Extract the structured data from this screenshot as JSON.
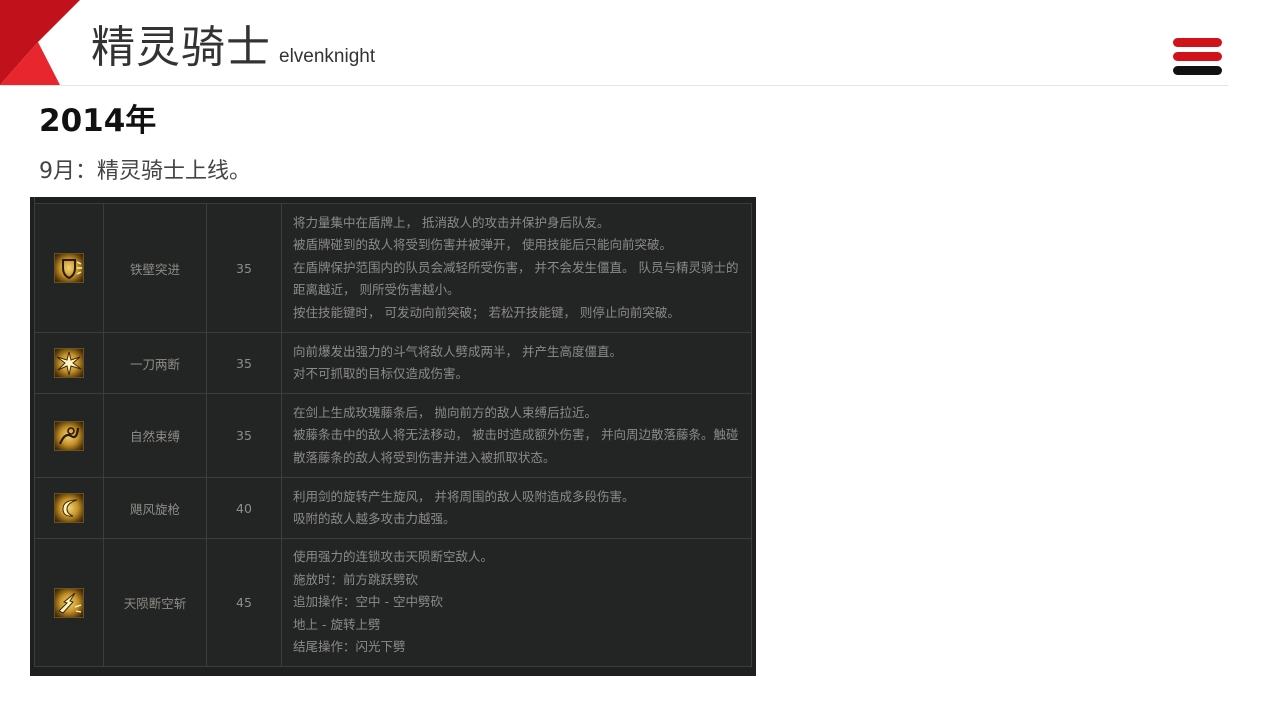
{
  "header": {
    "title": "精灵骑士",
    "subtitle": "elvenknight"
  },
  "colors": {
    "accent": "#d0121a",
    "menu_dark": "#111111"
  },
  "section": {
    "year": "2014年",
    "note": "9月：精灵骑士上线。"
  },
  "skills": [
    {
      "icon": "shield-dash-icon",
      "name": "铁壁突进",
      "level": "35",
      "lines": [
        "将力量集中在盾牌上， 抵消敌人的攻击并保护身后队友。",
        "被盾牌碰到的敌人将受到伤害并被弹开， 使用技能后只能向前突破。",
        "在盾牌保护范围内的队员会减轻所受伤害， 并不会发生僵直。 队员与精灵骑士的距离越近， 则所受伤害越小。",
        "按住技能键时， 可发动向前突破； 若松开技能键， 则停止向前突破。"
      ]
    },
    {
      "icon": "burst-slash-icon",
      "name": "一刀两断",
      "level": "35",
      "lines": [
        "向前爆发出强力的斗气将敌人劈成两半， 并产生高度僵直。",
        "对不可抓取的目标仅造成伤害。"
      ]
    },
    {
      "icon": "vine-bind-icon",
      "name": "自然束缚",
      "level": "35",
      "lines": [
        "在剑上生成玫瑰藤条后， 抛向前方的敌人束缚后拉近。",
        "被藤条击中的敌人将无法移动， 被击时造成额外伤害， 并向周边散落藤条。触碰散落藤条的敌人将受到伤害并进入被抓取状态。"
      ]
    },
    {
      "icon": "whirlwind-icon",
      "name": "飓风旋枪",
      "level": "40",
      "lines": [
        "利用剑的旋转产生旋风， 并将周围的敌人吸附造成多段伤害。",
        "吸附的敌人越多攻击力越强。"
      ]
    },
    {
      "icon": "sky-slash-icon",
      "name": "天陨断空斩",
      "level": "45",
      "lines": [
        "使用强力的连锁攻击天陨断空敌人。",
        "施放时：前方跳跃劈砍",
        "追加操作：空中 - 空中劈砍",
        "地上 - 旋转上劈",
        "结尾操作：闪光下劈"
      ]
    }
  ]
}
